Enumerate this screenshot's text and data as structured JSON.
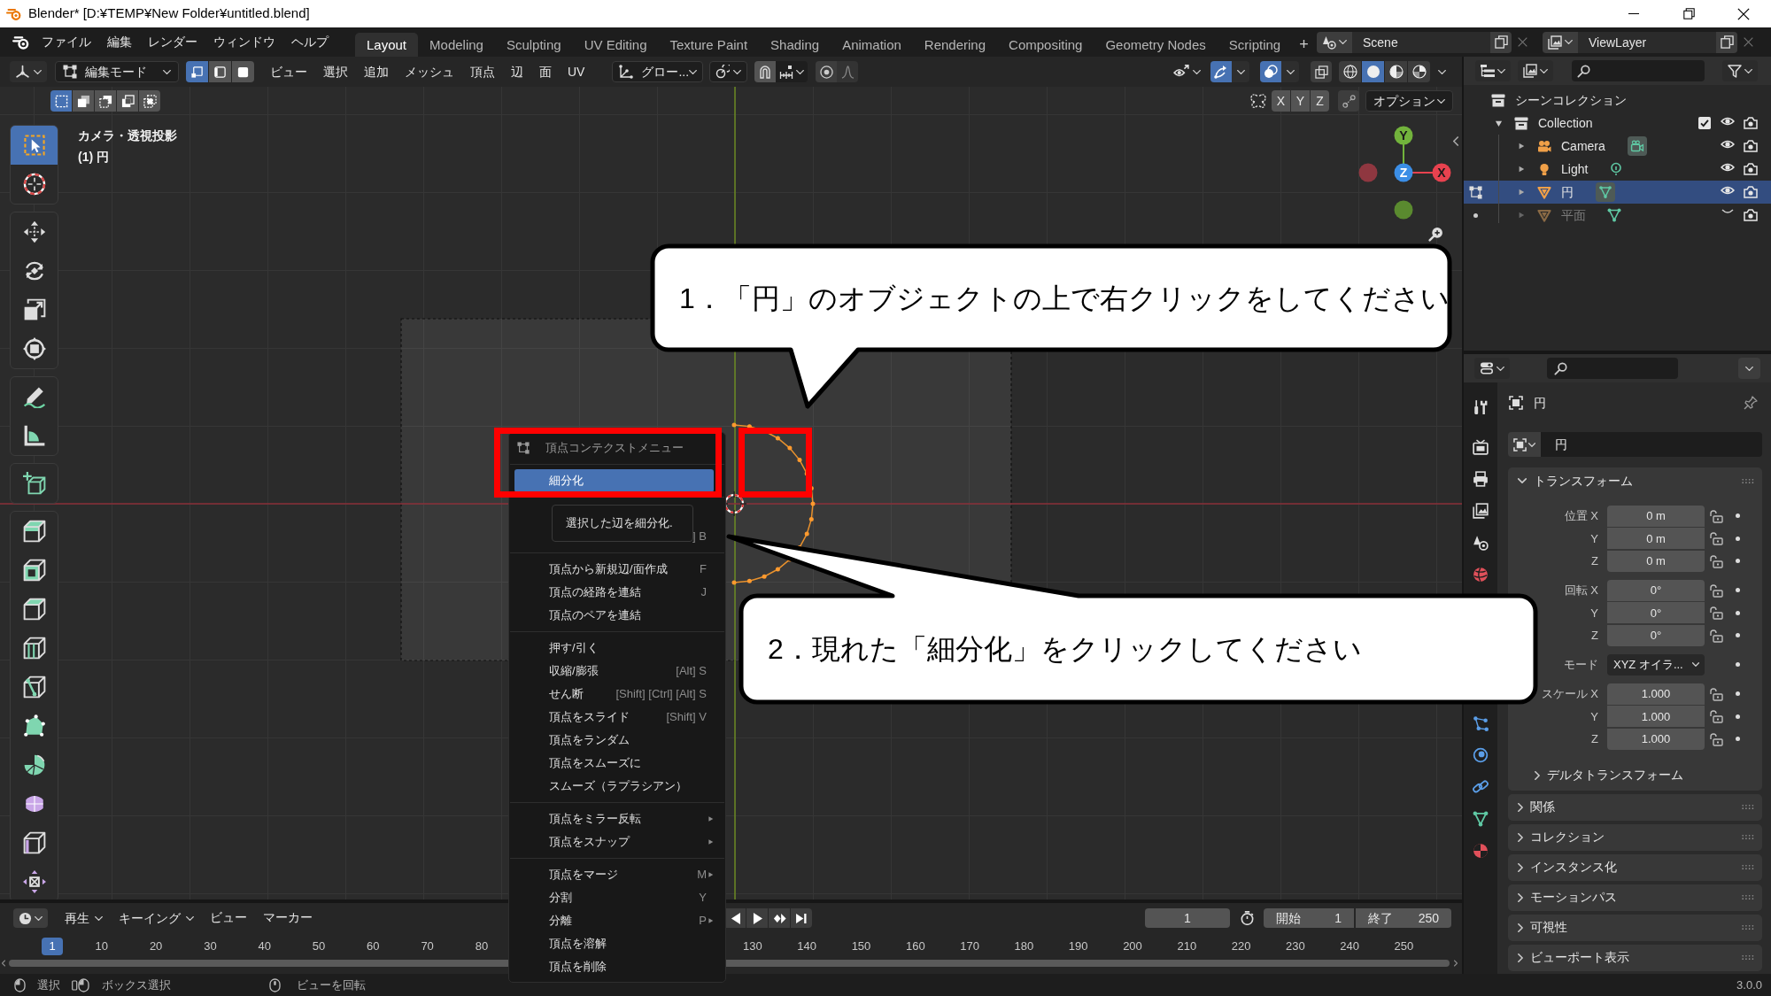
{
  "titlebar": {
    "title": "Blender* [D:¥TEMP¥New Folder¥untitled.blend]"
  },
  "menubar": {
    "menus": [
      "ファイル",
      "編集",
      "レンダー",
      "ウィンドウ",
      "ヘルプ"
    ],
    "workspaces": [
      {
        "label": "Layout",
        "selected": true
      },
      {
        "label": "Modeling",
        "selected": false
      },
      {
        "label": "Sculpting",
        "selected": false
      },
      {
        "label": "UV Editing",
        "selected": false
      },
      {
        "label": "Texture Paint",
        "selected": false
      },
      {
        "label": "Shading",
        "selected": false
      },
      {
        "label": "Animation",
        "selected": false
      },
      {
        "label": "Rendering",
        "selected": false
      },
      {
        "label": "Compositing",
        "selected": false
      },
      {
        "label": "Geometry Nodes",
        "selected": false
      },
      {
        "label": "Scripting",
        "selected": false
      }
    ],
    "add_workspace": "+",
    "scene": "Scene",
    "view_layer": "ViewLayer"
  },
  "viewport_header": {
    "mode": "編集モード",
    "select_modes": [
      {
        "selected": true
      },
      {
        "selected": false
      },
      {
        "selected": false
      }
    ],
    "menus": [
      "ビュー",
      "選択",
      "追加",
      "メッシュ",
      "頂点",
      "辺",
      "面",
      "UV"
    ],
    "orientation": "グロー...",
    "gizmos": true,
    "overlays": true,
    "xray": false,
    "shading": [
      {
        "selected": false
      },
      {
        "selected": true
      },
      {
        "selected": false
      },
      {
        "selected": false
      }
    ]
  },
  "tool_settings": {
    "select_modes": [
      {
        "selected": true
      },
      {
        "selected": false
      },
      {
        "selected": false
      },
      {
        "selected": false
      },
      {
        "selected": false
      }
    ],
    "mirror_axes": [
      {
        "label": "X",
        "on": false
      },
      {
        "label": "Y",
        "on": false
      },
      {
        "label": "Z",
        "on": false
      }
    ],
    "options": "オプション"
  },
  "toolbar": {
    "groups": [
      [
        {
          "selected": true
        },
        {
          "selected": false
        }
      ],
      [
        {
          "selected": false
        },
        {
          "selected": false
        },
        {
          "selected": false
        },
        {
          "selected": false
        }
      ],
      [
        {
          "selected": false
        },
        {
          "selected": false
        }
      ],
      [
        {
          "selected": false
        }
      ],
      [
        {
          "selected": false
        },
        {
          "selected": false
        },
        {
          "selected": false
        },
        {
          "selected": false
        },
        {
          "selected": false
        },
        {
          "selected": false
        },
        {
          "selected": false
        },
        {
          "selected": false
        },
        {
          "selected": false
        },
        {
          "selected": false
        }
      ]
    ]
  },
  "viewport": {
    "overlay_text": [
      "カメラ・透視投影",
      "(1) 円"
    ],
    "gizmo_axes": [
      "X",
      "Y",
      "Z"
    ]
  },
  "context_menu": {
    "title": "頂点コンテクストメニュー",
    "sections": [
      [
        {
          "label": "細分化",
          "selected": true,
          "submenu": false
        }
      ],
      [
        {
          "selected": false,
          "submenu": false
        },
        {
          "shortcut": "] B",
          "selected": false,
          "submenu": false
        }
      ],
      [
        {
          "label": "頂点から新規辺/面作成",
          "shortcut": "F",
          "selected": false,
          "submenu": false
        },
        {
          "label": "頂点の経路を連結",
          "shortcut": "J",
          "selected": false,
          "submenu": false
        },
        {
          "label": "頂点のペアを連結",
          "selected": false,
          "submenu": false
        }
      ],
      [
        {
          "label": "押す/引く",
          "selected": false,
          "submenu": false
        },
        {
          "label": "収縮/膨張",
          "shortcut": "[Alt] S",
          "selected": false,
          "submenu": false
        },
        {
          "label": "せん断",
          "shortcut": "[Shift] [Ctrl] [Alt] S",
          "selected": false,
          "submenu": false
        },
        {
          "label": "頂点をスライド",
          "shortcut": "[Shift] V",
          "selected": false,
          "submenu": false
        },
        {
          "label": "頂点をランダム",
          "selected": false,
          "submenu": false
        },
        {
          "label": "頂点をスムーズに",
          "selected": false,
          "submenu": false
        },
        {
          "label": "スムーズ（ラプラシアン）",
          "selected": false,
          "submenu": false
        }
      ],
      [
        {
          "label": "頂点をミラー反転",
          "selected": false,
          "submenu": true
        },
        {
          "label": "頂点をスナップ",
          "selected": false,
          "submenu": true
        }
      ],
      [
        {
          "label": "頂点をマージ",
          "shortcut": "M",
          "selected": false,
          "submenu": true
        },
        {
          "label": "分割",
          "shortcut": "Y",
          "selected": false,
          "submenu": false
        },
        {
          "label": "分離",
          "shortcut": "P",
          "selected": false,
          "submenu": true
        },
        {
          "label": "頂点を溶解",
          "selected": false,
          "submenu": false
        },
        {
          "label": "頂点を削除",
          "selected": false,
          "submenu": false
        }
      ]
    ],
    "tooltip": "選択した辺を細分化."
  },
  "callouts": [
    {
      "text": "1．「円」のオブジェクトの上で右クリックをしてください"
    },
    {
      "text": "2．現れた「細分化」をクリックしてください"
    }
  ],
  "outliner": {
    "root": "シーンコレクション",
    "tree": [
      {
        "label": "Collection",
        "expanded": true,
        "checked": true,
        "children": [
          {
            "label": "Camera",
            "kind": "camera",
            "expanded": false,
            "selected": false,
            "visible": true,
            "editing": false,
            "editable": false,
            "data_active": true
          },
          {
            "label": "Light",
            "kind": "light",
            "expanded": false,
            "selected": false,
            "visible": true,
            "editing": false,
            "editable": false,
            "data_active": false
          },
          {
            "label": "円",
            "kind": "mesh",
            "expanded": false,
            "selected": true,
            "visible": true,
            "editing": true,
            "data_active": true
          },
          {
            "label": "平面",
            "kind": "mesh",
            "expanded": false,
            "selected": false,
            "visible": false,
            "editing": false,
            "editable": true,
            "data_active": false
          }
        ]
      }
    ]
  },
  "properties": {
    "object_name": "円",
    "datablock": "円",
    "panels": [
      {
        "title": "トランスフォーム",
        "expanded": true,
        "groups": [
          [
            {
              "kind": "number",
              "label": "位置 X",
              "value": "0 m"
            },
            {
              "kind": "number",
              "label": "Y",
              "value": "0 m"
            },
            {
              "kind": "number",
              "label": "Z",
              "value": "0 m"
            }
          ],
          [
            {
              "kind": "number",
              "label": "回転 X",
              "value": "0°"
            },
            {
              "kind": "number",
              "label": "Y",
              "value": "0°"
            },
            {
              "kind": "number",
              "label": "Z",
              "value": "0°"
            }
          ],
          [
            {
              "kind": "dropdown",
              "label": "モード",
              "value": "XYZ オイラ..."
            }
          ],
          [
            {
              "kind": "number",
              "label": "スケール X",
              "value": "1.000"
            },
            {
              "kind": "number",
              "label": "Y",
              "value": "1.000"
            },
            {
              "kind": "number",
              "label": "Z",
              "value": "1.000"
            }
          ]
        ],
        "subpanels": [
          {
            "title": "デルタトランスフォーム",
            "expanded": false
          }
        ]
      },
      {
        "title": "関係",
        "expanded": false
      },
      {
        "title": "コレクション",
        "expanded": false
      },
      {
        "title": "インスタンス化",
        "expanded": false
      },
      {
        "title": "モーションパス",
        "expanded": false
      },
      {
        "title": "可視性",
        "expanded": false
      },
      {
        "title": "ビューポート表示",
        "expanded": false
      }
    ]
  },
  "timeline": {
    "menus": [
      {
        "label": "再生",
        "kind": "dropdown"
      },
      {
        "label": "キーイング",
        "kind": "dropdown"
      },
      {
        "label": "ビュー",
        "kind": "menu"
      },
      {
        "label": "マーカー",
        "kind": "menu"
      }
    ],
    "current_frame": "1",
    "start_label": "開始",
    "start": "1",
    "end_label": "終了",
    "end": "250",
    "ruler": {
      "current": "1",
      "labels": [
        [
          "10",
          "20",
          "30",
          "40",
          "50",
          "60",
          "70",
          "80"
        ],
        [
          "130",
          "140",
          "150",
          "160",
          "170",
          "180",
          "190",
          "200",
          "210",
          "220",
          "230",
          "240",
          "250"
        ]
      ]
    }
  },
  "status_bar": {
    "hints": [
      "選択",
      "ボックス選択",
      "ビューを回転"
    ],
    "version": "3.0.0"
  }
}
